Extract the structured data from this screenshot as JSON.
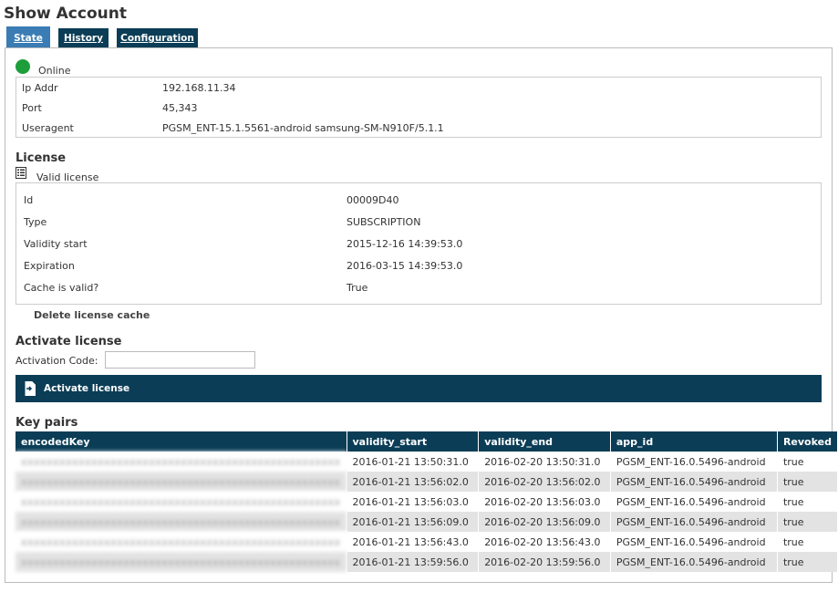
{
  "page": {
    "title": "Show Account"
  },
  "tabs": [
    {
      "label": "State",
      "active": true
    },
    {
      "label": "History",
      "active": false
    },
    {
      "label": "Configuration",
      "active": false
    }
  ],
  "status": {
    "label": "Online",
    "color": "#1e9e3a"
  },
  "connection": {
    "rows": [
      {
        "key": "Ip Addr",
        "value": "192.168.11.34"
      },
      {
        "key": "Port",
        "value": "45,343"
      },
      {
        "key": "Useragent",
        "value": "PGSM_ENT-15.1.5561-android samsung-SM-N910F/5.1.1"
      }
    ]
  },
  "license": {
    "title": "License",
    "status_label": "Valid license",
    "icon": "list-document-icon",
    "rows": [
      {
        "key": "Id",
        "value": "00009D40"
      },
      {
        "key": "Type",
        "value": "SUBSCRIPTION"
      },
      {
        "key": "Validity start",
        "value": "2015-12-16 14:39:53.0"
      },
      {
        "key": "Expiration",
        "value": "2016-03-15 14:39:53.0"
      },
      {
        "key": "Cache is valid?",
        "value": "True"
      }
    ],
    "delete_cache_label": "Delete license cache"
  },
  "activate": {
    "title": "Activate license",
    "code_label": "Activation Code:",
    "code_value": "",
    "button_label": "Activate license",
    "button_icon": "document-arrow-icon"
  },
  "key_pairs": {
    "title": "Key pairs",
    "columns": [
      "encodedKey",
      "validity_start",
      "validity_end",
      "app_id",
      "Revoked"
    ],
    "rows": [
      {
        "encodedKey": "xxxxxxxxxxxxxxxxxxxxxxxxxxxxxxxxxxxxxxxxxxxxxxxxxx",
        "validity_start": "2016-01-21 13:50:31.0",
        "validity_end": "2016-02-20 13:50:31.0",
        "app_id": "PGSM_ENT-16.0.5496-android",
        "revoked": "true"
      },
      {
        "encodedKey": "xxxxxxxxxxxxxxxxxxxxxxxxxxxxxxxxxxxxxxxxxxxxxxxxxx",
        "validity_start": "2016-01-21 13:56:02.0",
        "validity_end": "2016-02-20 13:56:02.0",
        "app_id": "PGSM_ENT-16.0.5496-android",
        "revoked": "true"
      },
      {
        "encodedKey": "xxxxxxxxxxxxxxxxxxxxxxxxxxxxxxxxxxxxxxxxxxxxxxxxxx",
        "validity_start": "2016-01-21 13:56:03.0",
        "validity_end": "2016-02-20 13:56:03.0",
        "app_id": "PGSM_ENT-16.0.5496-android",
        "revoked": "true"
      },
      {
        "encodedKey": "xxxxxxxxxxxxxxxxxxxxxxxxxxxxxxxxxxxxxxxxxxxxxxxxxx",
        "validity_start": "2016-01-21 13:56:09.0",
        "validity_end": "2016-02-20 13:56:09.0",
        "app_id": "PGSM_ENT-16.0.5496-android",
        "revoked": "true"
      },
      {
        "encodedKey": "xxxxxxxxxxxxxxxxxxxxxxxxxxxxxxxxxxxxxxxxxxxxxxxxxx",
        "validity_start": "2016-01-21 13:56:43.0",
        "validity_end": "2016-02-20 13:56:43.0",
        "app_id": "PGSM_ENT-16.0.5496-android",
        "revoked": "true"
      },
      {
        "encodedKey": "xxxxxxxxxxxxxxxxxxxxxxxxxxxxxxxxxxxxxxxxxxxxxxxxxx",
        "validity_start": "2016-01-21 13:59:56.0",
        "validity_end": "2016-02-20 13:59:56.0",
        "app_id": "PGSM_ENT-16.0.5496-android",
        "revoked": "true"
      }
    ]
  },
  "colors": {
    "brand": "#0b3d56",
    "active_tab": "#3a7cb3",
    "row_alt": "#e3e3e3"
  }
}
